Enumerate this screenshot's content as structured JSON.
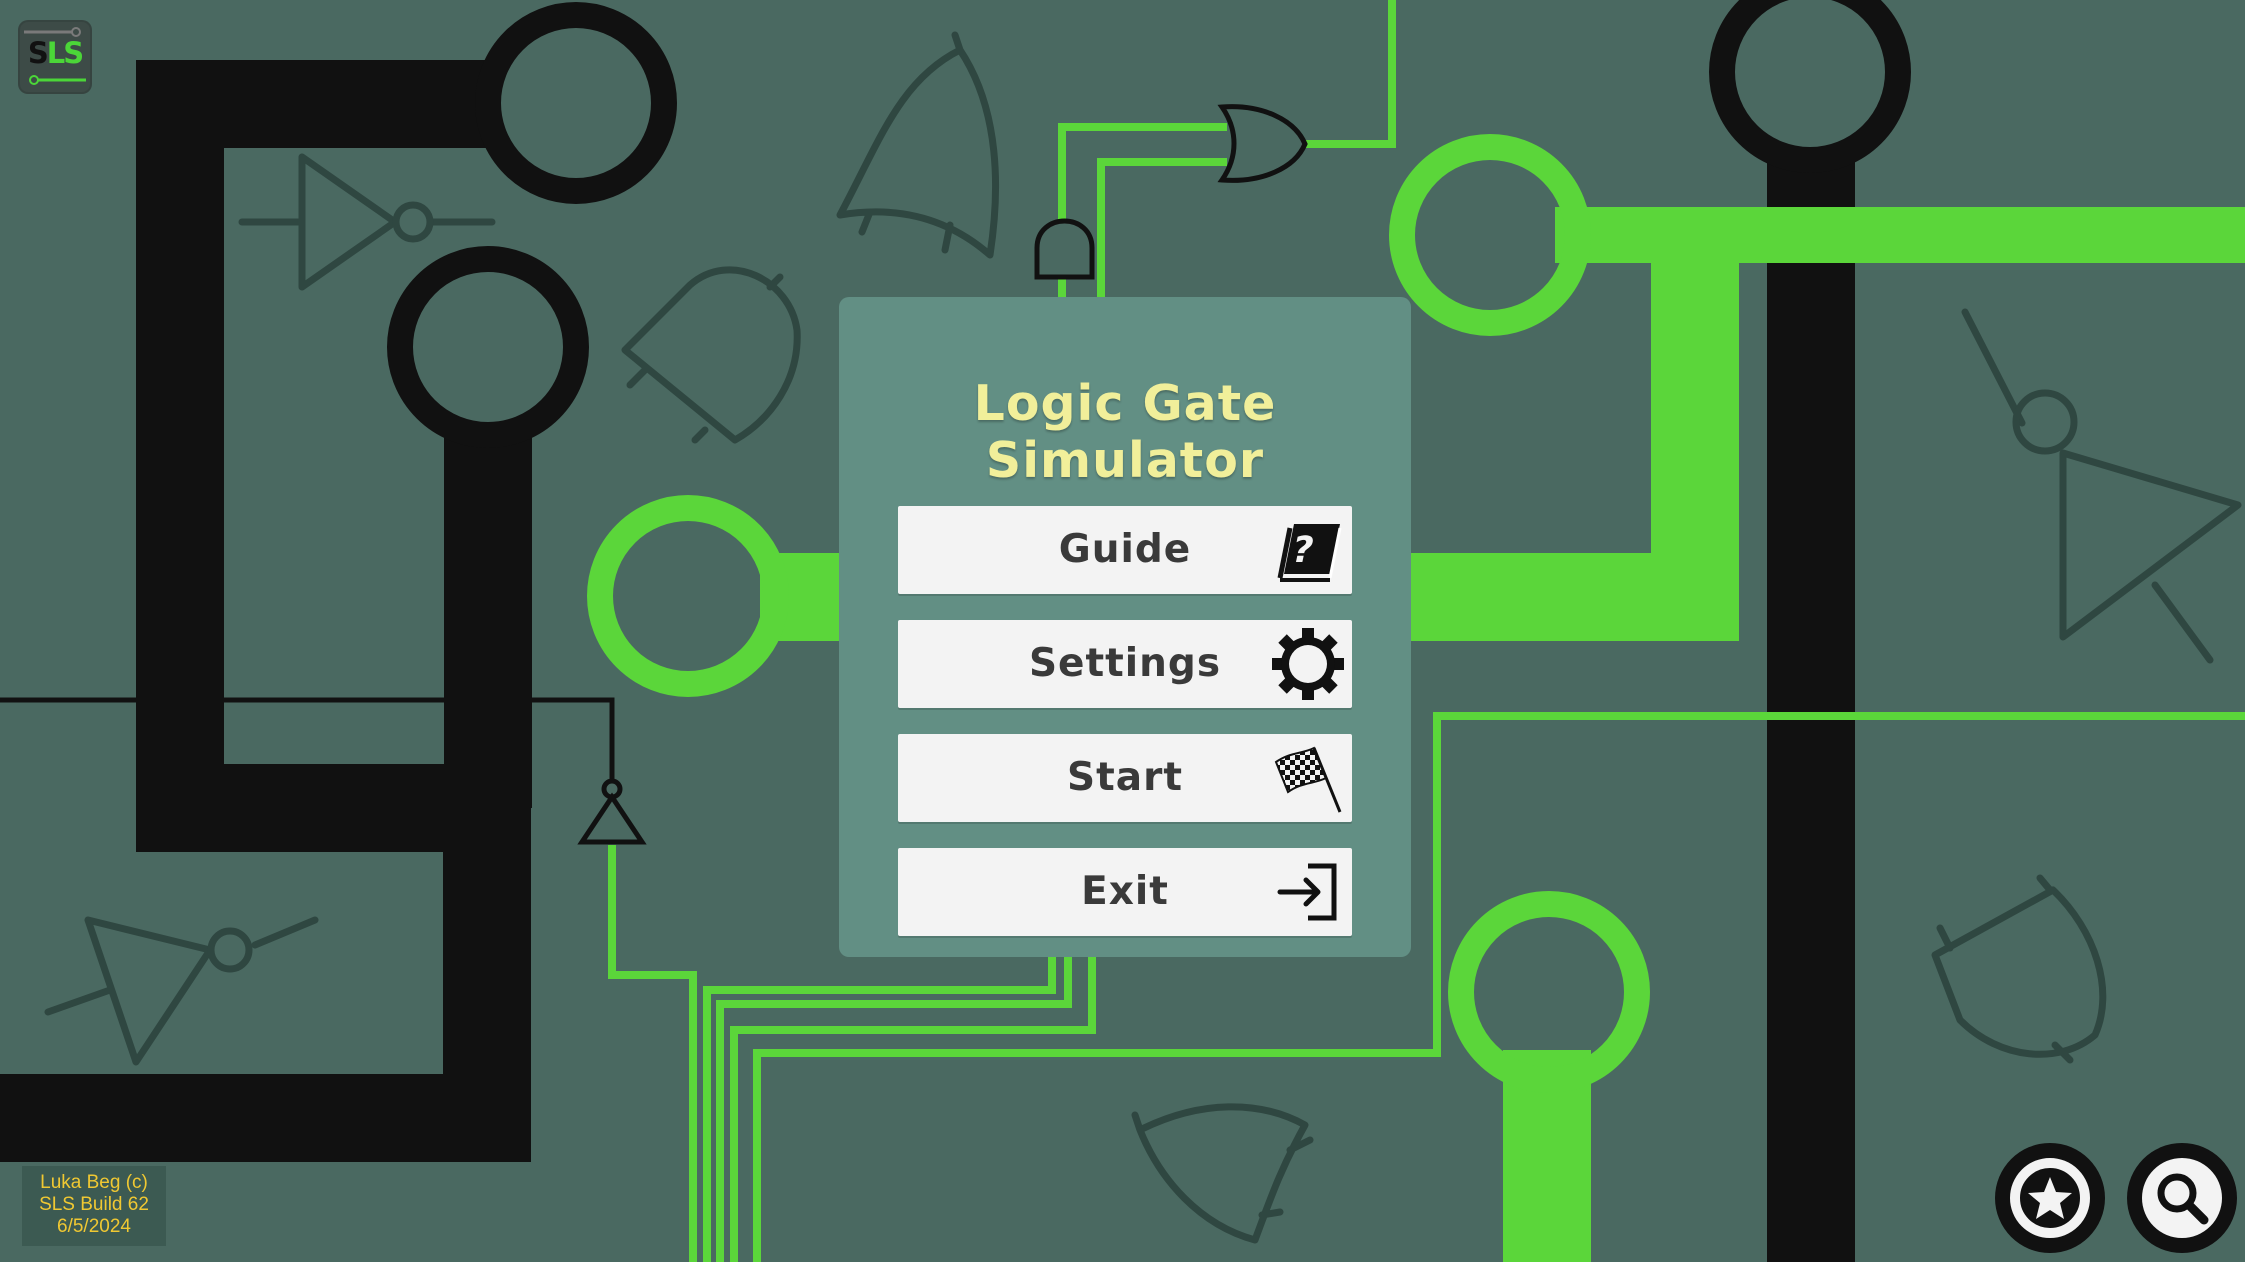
{
  "app": {
    "logo": {
      "line1": "S",
      "line2": "LS",
      "icon": "sls-logo-icon"
    }
  },
  "menu": {
    "title": "Logic Gate Simulator",
    "buttons": [
      {
        "label": "Guide",
        "icon": "guide-book-icon"
      },
      {
        "label": "Settings",
        "icon": "gear-icon"
      },
      {
        "label": "Start",
        "icon": "checkered-flag-icon"
      },
      {
        "label": "Exit",
        "icon": "exit-icon"
      }
    ]
  },
  "credits": {
    "author": "Luka Beg (c)",
    "build": "SLS Build 62",
    "date": "6/5/2024"
  },
  "corner_buttons": [
    {
      "icon": "star-icon"
    },
    {
      "icon": "search-icon"
    }
  ],
  "colors": {
    "background": "#4a6961",
    "wire_black": "#111111",
    "wire_green": "#5bd63a",
    "gate_outline": "#2f4741",
    "panel": "#628f84",
    "title": "#f1ef9a",
    "button": "#f3f3f3",
    "credits_text": "#f0c832"
  }
}
